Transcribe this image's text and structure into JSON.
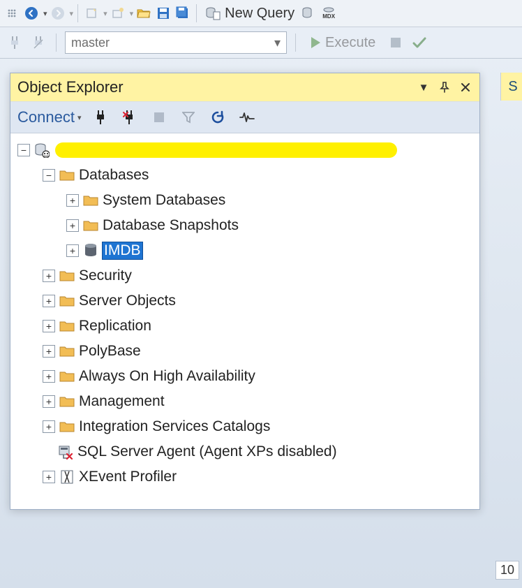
{
  "main_toolbar": {
    "new_query_label": "New Query"
  },
  "query_toolbar": {
    "database": "master",
    "execute_label": "Execute"
  },
  "panel": {
    "title": "Object Explorer",
    "connect_label": "Connect"
  },
  "right_sliver": "S",
  "bottom_number": "10",
  "tree": {
    "server_label": "",
    "databases": {
      "label": "Databases",
      "children": {
        "system": "System Databases",
        "snapshots": "Database Snapshots",
        "imdb": "IMDB"
      }
    },
    "security": "Security",
    "server_objects": "Server Objects",
    "replication": "Replication",
    "polybase": "PolyBase",
    "aoha": "Always On High Availability",
    "management": "Management",
    "isc": "Integration Services Catalogs",
    "agent": "SQL Server Agent (Agent XPs disabled)",
    "xevent": "XEvent Profiler"
  }
}
